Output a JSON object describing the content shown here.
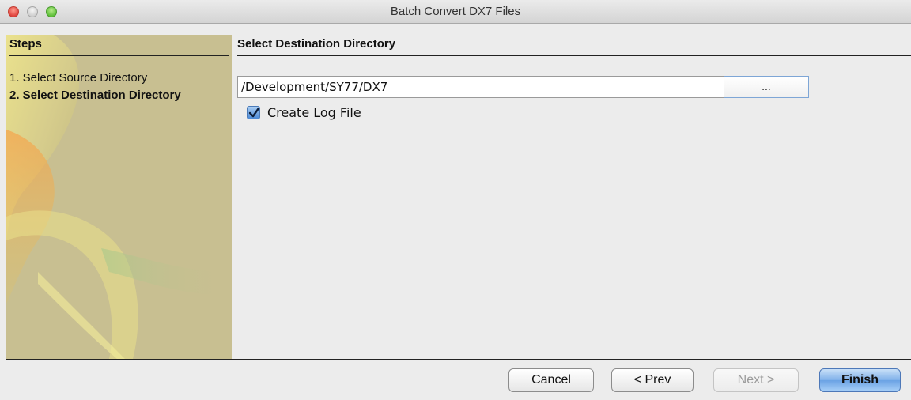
{
  "window": {
    "title": "Batch Convert DX7 Files"
  },
  "steps": {
    "header": "Steps",
    "items": [
      {
        "label": "1. Select Source Directory",
        "current": false
      },
      {
        "label": "2. Select Destination Directory",
        "current": true
      }
    ]
  },
  "content": {
    "header": "Select Destination Directory",
    "path_value": "/Development/SY77/DX7",
    "browse_label": "...",
    "create_log_label": "Create Log File",
    "create_log_checked": true
  },
  "footer": {
    "cancel_label": "Cancel",
    "prev_label": "< Prev",
    "next_label": "Next >",
    "finish_label": "Finish",
    "next_enabled": false
  },
  "colors": {
    "accent": "#4b8ad6",
    "steps_panel": "#c8bf91"
  }
}
